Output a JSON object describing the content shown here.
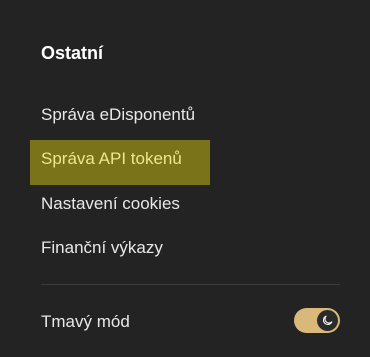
{
  "section": {
    "title": "Ostatní"
  },
  "menu": {
    "items": [
      {
        "label": "Správa eDisponentů"
      },
      {
        "label": "Správa API tokenů"
      },
      {
        "label": "Nastavení cookies"
      },
      {
        "label": "Finanční výkazy"
      }
    ]
  },
  "dark_mode": {
    "label": "Tmavý mód",
    "enabled": true,
    "icon": "moon-icon"
  },
  "colors": {
    "background": "#232323",
    "highlight": "#7a7319",
    "highlight_text": "#f0e68c",
    "toggle_track": "#d9b97a"
  }
}
